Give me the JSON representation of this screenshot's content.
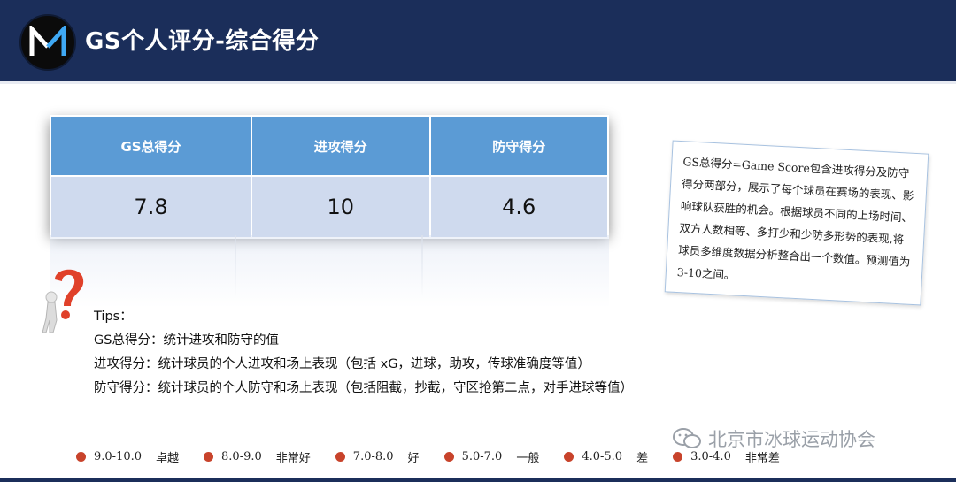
{
  "header": {
    "title": "GS个人评分-综合得分",
    "logo_letter": "M"
  },
  "score_table": {
    "headers": [
      "GS总得分",
      "进攻得分",
      "防守得分"
    ],
    "values": [
      "7.8",
      "10",
      "4.6"
    ]
  },
  "note": {
    "text": "GS总得分=Game Score包含进攻得分及防守得分两部分，展示了每个球员在赛场的表现、影响球队获胜的机会。根据球员不同的上场时间、双方人数相等、多打少和少防多形势的表现,将球员多维度数据分析整合出一个数值。预测值为3-10之间。"
  },
  "tips": {
    "title": "Tips：",
    "lines": [
      "GS总得分：统计进攻和防守的值",
      "进攻得分：统计球员的个人进攻和场上表现（包括 xG，进球，助攻，传球准确度等值）",
      "防守得分：统计球员的个人防守和场上表现（包括阻截，抄截，守区抢第二点，对手进球等值）"
    ]
  },
  "legend": [
    {
      "range": "9.0-10.0",
      "label": "卓越"
    },
    {
      "range": "8.0-9.0",
      "label": "非常好"
    },
    {
      "range": "7.0-8.0",
      "label": "好"
    },
    {
      "range": "5.0-7.0",
      "label": "一般"
    },
    {
      "range": "4.0-5.0",
      "label": "差"
    },
    {
      "range": "3.0-4.0",
      "label": "非常差"
    }
  ],
  "watermark": {
    "text": "北京市冰球运动协会",
    "icon": "wechat-icon"
  },
  "colors": {
    "header_bg": "#1b2e5a",
    "table_header": "#5b9bd5",
    "table_cell": "#cfdaee",
    "legend_dot": "#c8432b"
  }
}
